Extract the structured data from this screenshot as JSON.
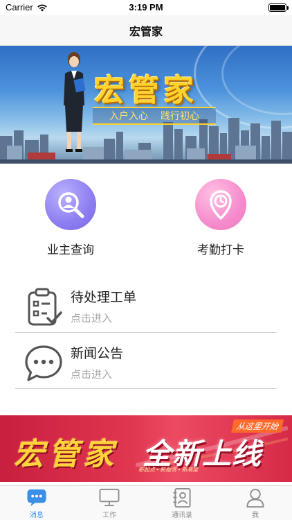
{
  "status_bar": {
    "carrier": "Carrier",
    "time": "3:19 PM"
  },
  "nav": {
    "title": "宏管家"
  },
  "top_banner": {
    "brand": "宏管家",
    "slogan_left": "入户入心",
    "slogan_right": "践行初心"
  },
  "quick_actions": [
    {
      "label": "业主查询",
      "icon": "search-user-icon"
    },
    {
      "label": "考勤打卡",
      "icon": "location-clock-icon"
    }
  ],
  "list": [
    {
      "title": "待处理工单",
      "subtitle": "点击进入",
      "icon": "clipboard-checklist-icon"
    },
    {
      "title": "新闻公告",
      "subtitle": "点击进入",
      "icon": "chat-bubble-icon"
    }
  ],
  "bottom_banner": {
    "brand": "宏管家",
    "ribbon": "从这里开始",
    "headline": "全新上线",
    "tagline": "新起点 • 新服务 • 新高度"
  },
  "tabs": [
    {
      "label": "消息",
      "icon": "message-icon",
      "active": true
    },
    {
      "label": "工作",
      "icon": "monitor-icon",
      "active": false
    },
    {
      "label": "通讯录",
      "icon": "contacts-icon",
      "active": false
    },
    {
      "label": "我",
      "icon": "person-icon",
      "active": false
    }
  ],
  "colors": {
    "accent": "#3a8fe8",
    "purple": "#8c7df0",
    "pink": "#f58ccd",
    "banner_red": "#d62a47"
  }
}
